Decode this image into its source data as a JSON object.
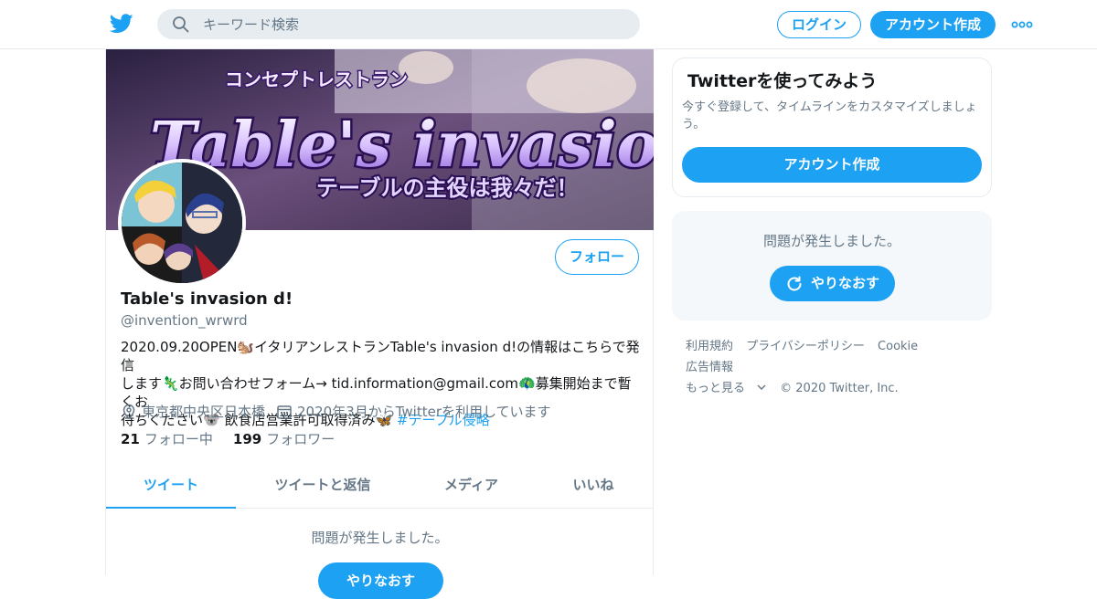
{
  "header": {
    "search_placeholder": "キーワード検索",
    "login_label": "ログイン",
    "signup_label": "アカウント作成"
  },
  "profile": {
    "banner_text_top": "コンセプトレストラン",
    "banner_title": "Table's invasion",
    "banner_subtitle": "テーブルの主役は我々だ！",
    "follow_label": "フォロー",
    "name": "Table's invasion d!",
    "handle": "@invention_wrwrd",
    "bio_line1": "2020.09.20OPEN🐿️イタリアンレストランTable's invasion d!の情報はこちらで発信",
    "bio_line2": "します🦎お問い合わせフォーム→ tid.information@gmail.com🦚募集開始まで暫くお",
    "bio_line3": "待ちください🐨 飲食店営業許可取得済み🦋",
    "bio_hashtag": "#テーブル侵略",
    "location": "東京都中央区日本橋",
    "joined": "2020年3月からTwitterを利用しています",
    "following_count": "21",
    "following_label": "フォロー中",
    "followers_count": "199",
    "followers_label": "フォロワー"
  },
  "tabs": [
    {
      "label": "ツイート"
    },
    {
      "label": "ツイートと返信"
    },
    {
      "label": "メディア"
    },
    {
      "label": "いいね"
    }
  ],
  "timeline": {
    "error_text": "問題が発生しました。"
  },
  "sidebar": {
    "title": "Twitterを使ってみよう",
    "desc": "今すぐ登録して、タイムラインをカスタマイズしましょう。",
    "signup_label": "アカウント作成",
    "error_text": "問題が発生しました。",
    "retry_label": "やりなおす"
  },
  "footer": {
    "terms": "利用規約",
    "privacy": "プライバシーポリシー",
    "cookie": "Cookie",
    "ads": "広告情報",
    "more": "もっと見る",
    "copyright": "© 2020 Twitter, Inc."
  },
  "colors": {
    "accent": "#1da1f2",
    "muted": "#657786",
    "text": "#14171a"
  }
}
